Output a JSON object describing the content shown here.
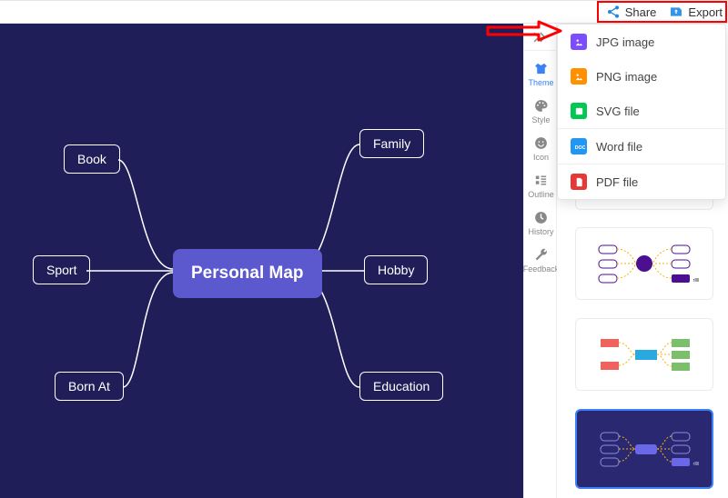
{
  "topbar": {
    "share_label": "Share",
    "export_label": "Export"
  },
  "canvas": {
    "center": "Personal Map",
    "nodes": {
      "book": "Book",
      "family": "Family",
      "sport": "Sport",
      "hobby": "Hobby",
      "born_at": "Born At",
      "education": "Education"
    }
  },
  "rail": {
    "theme": "Theme",
    "style": "Style",
    "icon": "Icon",
    "outline": "Outline",
    "history": "History",
    "feedback": "Feedback"
  },
  "export_menu": {
    "jpg": "JPG image",
    "png": "PNG image",
    "svg": "SVG file",
    "word": "Word file",
    "pdf": "PDF file"
  }
}
